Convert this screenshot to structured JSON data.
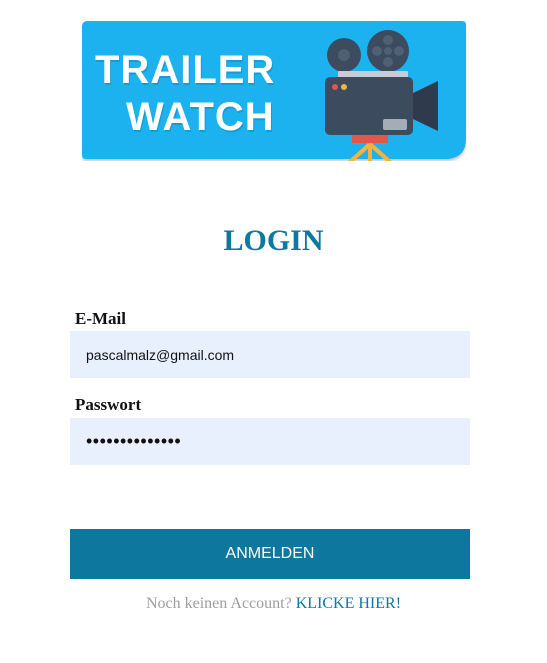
{
  "logo": {
    "line1": "TRAILER",
    "line2": "WATCH",
    "icon": "movie-camera-icon",
    "background_color": "#1ab1ef"
  },
  "title": "LOGIN",
  "form": {
    "email_label": "E-Mail",
    "email_value": "pascalmalz@gmail.com",
    "password_label": "Passwort",
    "password_value": "••••••••••••••"
  },
  "button": {
    "label": "ANMELDEN"
  },
  "footer": {
    "text": "Noch keinen Account?",
    "link": "KLICKE HIER!"
  },
  "colors": {
    "accent": "#0e779e",
    "input_bg": "#e8f0fe",
    "muted": "#9e9e9e"
  }
}
